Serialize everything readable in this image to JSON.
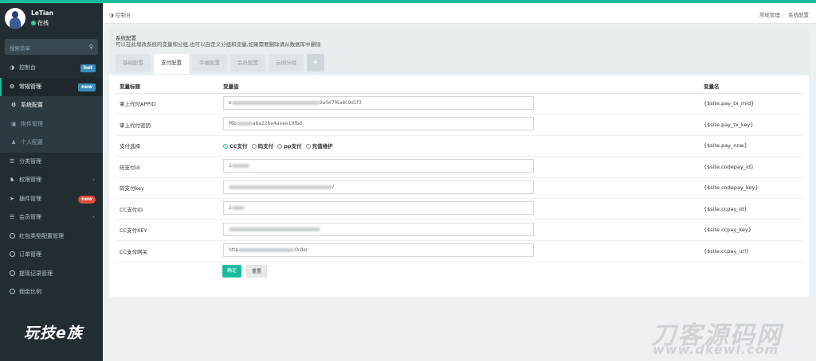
{
  "user": {
    "name": "LeTian",
    "status": "在线"
  },
  "search": {
    "placeholder": "搜索菜单"
  },
  "sidebar": {
    "items": [
      {
        "label": "控制台",
        "badge": "hot"
      },
      {
        "label": "常规管理",
        "badge": "new"
      },
      {
        "label": "系统配置"
      },
      {
        "label": "附件管理"
      },
      {
        "label": "个人配置"
      },
      {
        "label": "分类管理"
      },
      {
        "label": "权限管理"
      },
      {
        "label": "插件管理",
        "badge": "new"
      },
      {
        "label": "会员管理"
      },
      {
        "label": "红包类型配置管理"
      },
      {
        "label": "订单管理"
      },
      {
        "label": "提现记录管理"
      },
      {
        "label": "佣金比例"
      }
    ]
  },
  "watermark_left": "玩技e族",
  "header": {
    "home": "控制台",
    "breadcrumb": [
      "常规管理",
      "系统配置"
    ]
  },
  "panel": {
    "title": "系统配置",
    "description": "可以在此增改系统的变量和分组,也可以自定义分组和变量,如果需要删除请从数据库中删除",
    "tabs": [
      "基础配置",
      "支付配置",
      "手機配置",
      "会员配置",
      "示例分组",
      "+"
    ]
  },
  "table": {
    "headers": [
      "变量标题",
      "变量值",
      "变量名"
    ],
    "rows": [
      {
        "title": "掌上代付APPID",
        "value": "e",
        "value_tail": "9a0d7f6a8c9d1f3",
        "name": "{$site.pay_tx_mid}"
      },
      {
        "title": "掌上代付密钥",
        "value": "f6b",
        "value_tail": "a8a22be4aeee19fbd",
        "name": "{$site.pay_tx_key}"
      },
      {
        "title": "支付选择",
        "name": "{$site.pay_now}"
      },
      {
        "title": "码支付id",
        "value": "1",
        "value_tail": "",
        "name": "{$site.codepay_id}"
      },
      {
        "title": "码支付key",
        "value": "",
        "value_tail": "/",
        "name": "{$site.codepay_key}"
      },
      {
        "title": "CC支付ID",
        "value": "1",
        "value_tail": "",
        "name": "{$site.ccpay_id}"
      },
      {
        "title": "CC支付KEY",
        "value": "",
        "value_tail": "",
        "name": "{$site.ccpay_key}"
      },
      {
        "title": "CC支付网关",
        "value": "http",
        "value_tail": "Order",
        "name": "{$site.ccpay_url}"
      }
    ]
  },
  "pay_options": [
    "CC支付",
    "码支付",
    "pp支付",
    "充值维护"
  ],
  "buttons": {
    "ok": "确定",
    "reset": "重置"
  },
  "watermark_right": {
    "brand": "刀客源码网",
    "url": "www.dkewl.com"
  }
}
